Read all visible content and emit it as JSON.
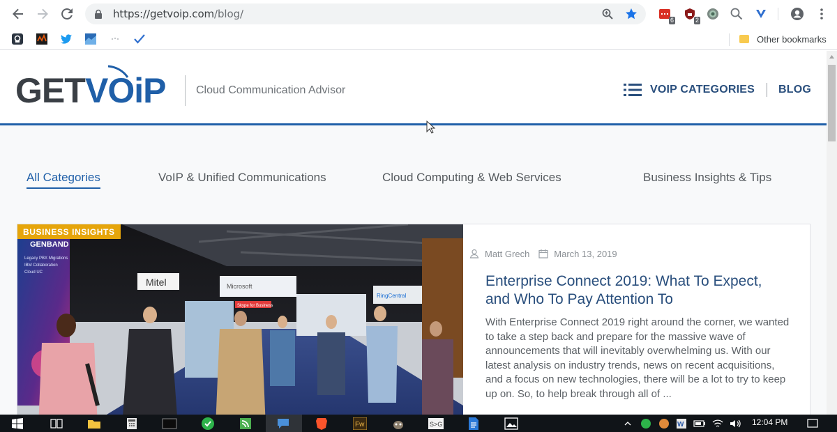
{
  "browser": {
    "url_host": "https://getvoip.com",
    "url_path": "/blog/",
    "extension_badges": [
      "6",
      "2"
    ],
    "other_bookmarks": "Other bookmarks"
  },
  "site": {
    "logo_text": "GETVOiP",
    "tagline": "Cloud Communication Advisor",
    "nav_categories": "VOIP CATEGORIES",
    "nav_blog": "BLOG"
  },
  "categories": [
    {
      "label": "All Categories"
    },
    {
      "label": "VoIP & Unified Communications"
    },
    {
      "label": "Cloud Computing & Web Services"
    },
    {
      "label": "Business Insights & Tips"
    }
  ],
  "post": {
    "tag": "BUSINESS INSIGHTS",
    "author": "Matt Grech",
    "date": "March 13, 2019",
    "title": "Enterprise Connect 2019: What To Expect, and Who To Pay Attention To",
    "excerpt": "With Enterprise Connect 2019 right around the corner, we wanted to take a step back and prepare for the massive wave of announcements that will inevitably overwhelming us. With our latest analysis on industry trends, news on recent acquisitions, and a focus on new technologies, there will be a lot to try to keep up on. So, to help break through all of ...",
    "photo_signs": {
      "genband": "GENBAND",
      "genband_lines": "Legacy PBX Migrations\nIBM Collaboration\nCloud UC",
      "mitel": "Mitel",
      "microsoft": "Microsoft",
      "ringcentral": "RingCentral",
      "skype": "Skype for Business"
    }
  },
  "taskbar": {
    "time": "12:04 PM"
  },
  "colors": {
    "brand_blue": "#1f5fa8",
    "nav_text": "#2a4f7d",
    "tag_bg": "#e6a50a",
    "logo_dark": "#3a3f45"
  }
}
